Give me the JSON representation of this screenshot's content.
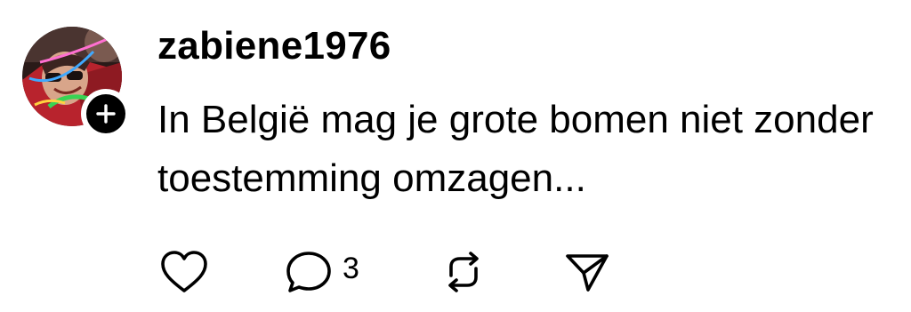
{
  "post": {
    "username": "zabiene1976",
    "text": "In België mag je grote bomen niet zonder toestemming omzagen...",
    "reply_count": "3"
  },
  "icons": {
    "like": "heart-icon",
    "reply": "comment-icon",
    "repost": "repost-icon",
    "share": "send-icon",
    "follow": "plus-icon"
  },
  "colors": {
    "text": "#000000",
    "background": "#ffffff"
  }
}
